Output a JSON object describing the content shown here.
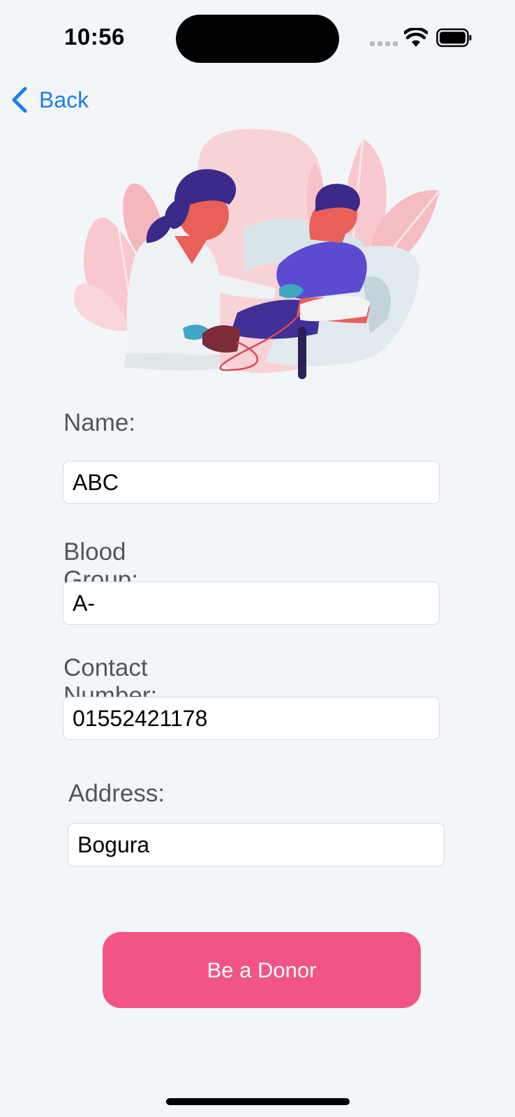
{
  "status_bar": {
    "time": "10:56"
  },
  "nav": {
    "back_label": "Back",
    "accent_color": "#1a7fe8"
  },
  "hero": {
    "icon": "blood-donation-illustration"
  },
  "form": {
    "name": {
      "label": "Name:",
      "value": "ABC"
    },
    "blood_group": {
      "label": "Blood Group:",
      "value": "A-"
    },
    "contact_number": {
      "label": "Contact Number:",
      "value": "01552421178"
    },
    "address": {
      "label": "Address:",
      "value": "Bogura"
    }
  },
  "actions": {
    "submit_label": "Be a Donor",
    "submit_color": "#f25585"
  }
}
